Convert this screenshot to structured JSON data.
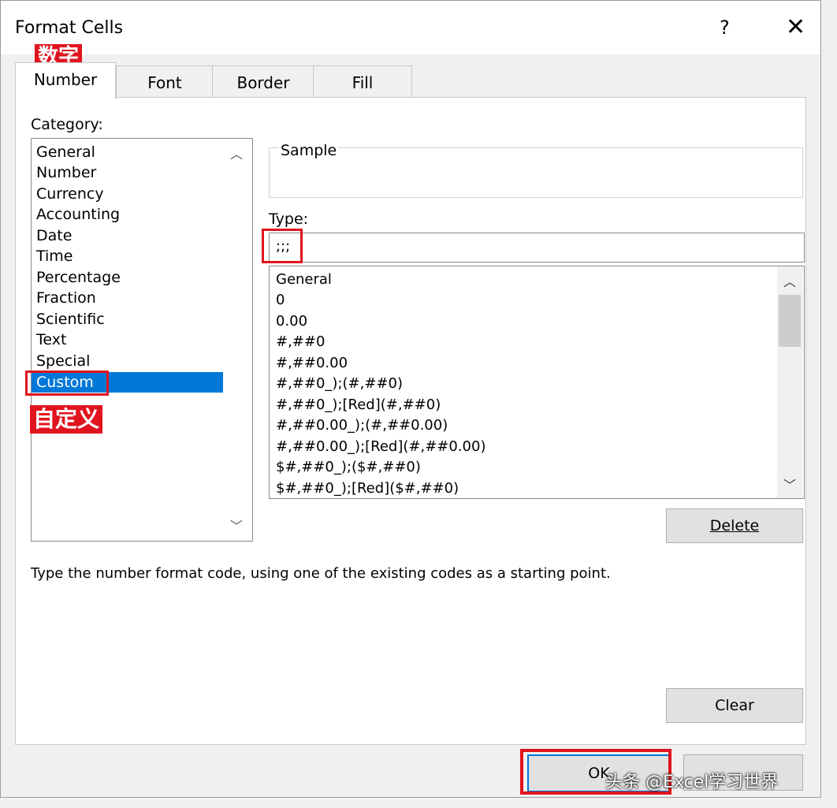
{
  "dialog": {
    "title": "Format Cells",
    "help": "?",
    "close": "✕"
  },
  "tabs": [
    "Number",
    "Font",
    "Border",
    "Fill"
  ],
  "category": {
    "label": "Category:",
    "items": [
      "General",
      "Number",
      "Currency",
      "Accounting",
      "Date",
      "Time",
      "Percentage",
      "Fraction",
      "Scientific",
      "Text",
      "Special",
      "Custom"
    ],
    "selected": "Custom"
  },
  "sample": {
    "label": "Sample",
    "value": ""
  },
  "type": {
    "label": "Type:",
    "value": ";;;",
    "items": [
      "General",
      "0",
      "0.00",
      "#,##0",
      "#,##0.00",
      "#,##0_);(#,##0)",
      "#,##0_);[Red](#,##0)",
      "#,##0.00_);(#,##0.00)",
      "#,##0.00_);[Red](#,##0.00)",
      "$#,##0_);($#,##0)",
      "$#,##0_);[Red]($#,##0)"
    ]
  },
  "buttons": {
    "delete": "Delete",
    "clear": "Clear",
    "ok": "OK"
  },
  "hint": "Type the number format code, using one of the existing codes as a starting point.",
  "annotations": {
    "number_cn": "数字",
    "custom_cn": "自定义"
  },
  "watermark": "头条 @Excel学习世界",
  "colors": {
    "selection": "#0078d7",
    "annotation": "#e0141e"
  }
}
